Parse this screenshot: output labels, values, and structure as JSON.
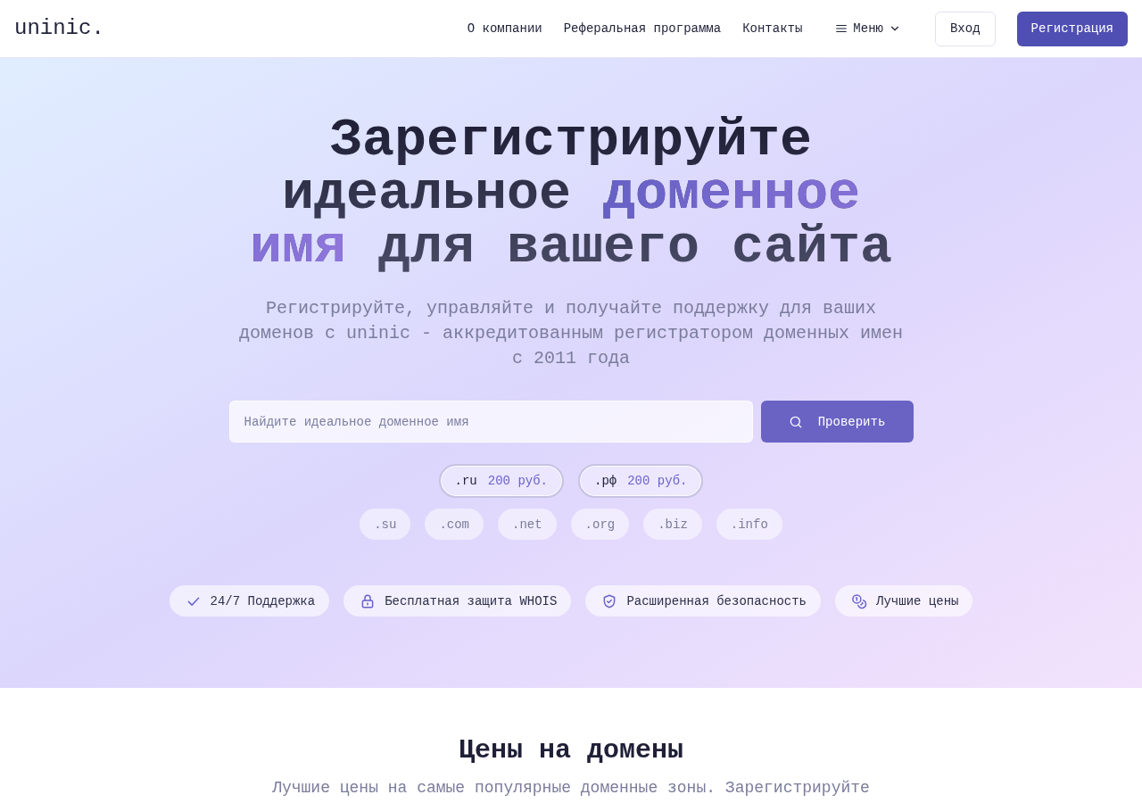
{
  "header": {
    "logo": "uninic.",
    "nav": [
      {
        "label": "О компании"
      },
      {
        "label": "Реферальная программа"
      },
      {
        "label": "Контакты"
      }
    ],
    "menu": {
      "label": "Меню"
    },
    "login": "Вход",
    "register": "Регистрация"
  },
  "hero": {
    "title": [
      {
        "text": "Зарегистрируйте идеальное",
        "kind": "plain"
      },
      {
        "text": "доменное имя",
        "kind": "accent"
      },
      {
        "text": "для вашего сайта",
        "kind": "plain"
      }
    ],
    "subtitle": "Регистрируйте, управляйте и получайте поддержку для ваших доменов с uninic - аккредитованным регистратором доменных имен с 2011 года",
    "search": {
      "placeholder": "Найдите идеальное доменное имя",
      "button": "Проверить"
    },
    "featured_zones": [
      {
        "zone": ".ru",
        "price": "200 руб."
      },
      {
        "zone": ".рф",
        "price": "200 руб."
      }
    ],
    "zones": [
      ".su",
      ".com",
      ".net",
      ".org",
      ".biz",
      ".info"
    ],
    "features": [
      {
        "label": "24/7 Поддержка"
      },
      {
        "label": "Бесплатная защита WHOIS"
      },
      {
        "label": "Расширенная безопасность"
      },
      {
        "label": "Лучшие цены"
      }
    ]
  },
  "pricing": {
    "title": "Цены на домены",
    "subtitle": "Лучшие цены на самые популярные доменные зоны. Зарегистрируйте"
  }
}
